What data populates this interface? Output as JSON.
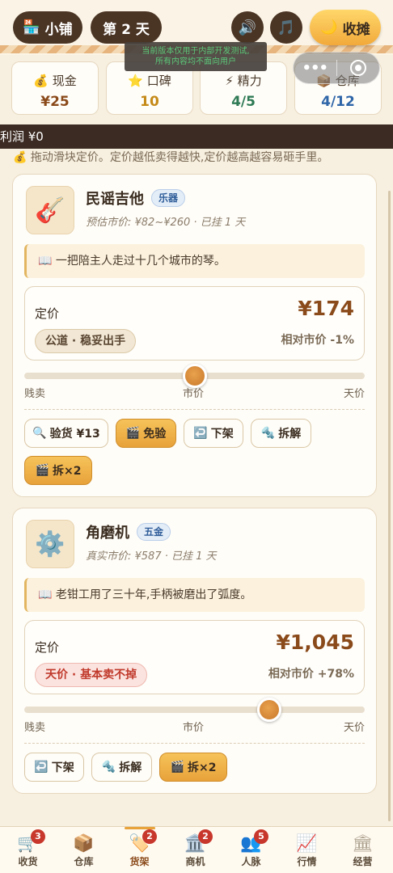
{
  "header": {
    "shop_label": "小铺",
    "day_label": "第 2 天",
    "close_label": "收摊",
    "notice_line1": "当前版本仅用于内部开发测试,",
    "notice_line2": "所有内容均不面向用户",
    "capsule_more": "•••"
  },
  "stats": [
    {
      "label": "现金",
      "value": "¥25",
      "icon": "moneybag-icon"
    },
    {
      "label": "口碑",
      "value": "10",
      "icon": "star-icon"
    },
    {
      "label": "精力",
      "value": "4/5",
      "icon": "lightning-icon"
    },
    {
      "label": "仓库",
      "value": "4/12",
      "icon": "box-icon"
    }
  ],
  "profit_text": "利润 ¥0",
  "hint_text": "💰 拖动滑块定价。定价越低卖得越快,定价越高越容易砸手里。",
  "items": [
    {
      "name": "民谣吉他",
      "tag": "乐器",
      "sub": "预估市价: ¥82~¥260 · 已挂 1 天",
      "quote": "📖 一把陪主人走过十几个城市的琴。",
      "price_label": "定价",
      "price": "¥174",
      "badge": "公道 · 稳妥出手",
      "relative": "相对市价 -1%",
      "slider_position": 0.5,
      "scale": [
        "贱卖",
        "市价",
        "天价"
      ],
      "actions": [
        "验货 ¥13",
        "免验",
        "下架",
        "拆解",
        "拆×2"
      ]
    },
    {
      "name": "角磨机",
      "tag": "五金",
      "sub": "真实市价: ¥587 · 已挂 1 天",
      "quote": "📖 老钳工用了三十年,手柄被磨出了弧度。",
      "price_label": "定价",
      "price": "¥1,045",
      "badge": "天价 · 基本卖不掉",
      "relative": "相对市价 +78%",
      "slider_position": 0.72,
      "scale": [
        "贱卖",
        "市价",
        "天价"
      ],
      "actions": [
        "下架",
        "拆解",
        "拆×2"
      ]
    }
  ],
  "nav": [
    {
      "label": "收货",
      "badge": "3"
    },
    {
      "label": "仓库",
      "badge": ""
    },
    {
      "label": "货架",
      "badge": "2"
    },
    {
      "label": "商机",
      "badge": "2"
    },
    {
      "label": "人脉",
      "badge": "5"
    },
    {
      "label": "行情",
      "badge": ""
    },
    {
      "label": "经营",
      "badge": ""
    }
  ]
}
